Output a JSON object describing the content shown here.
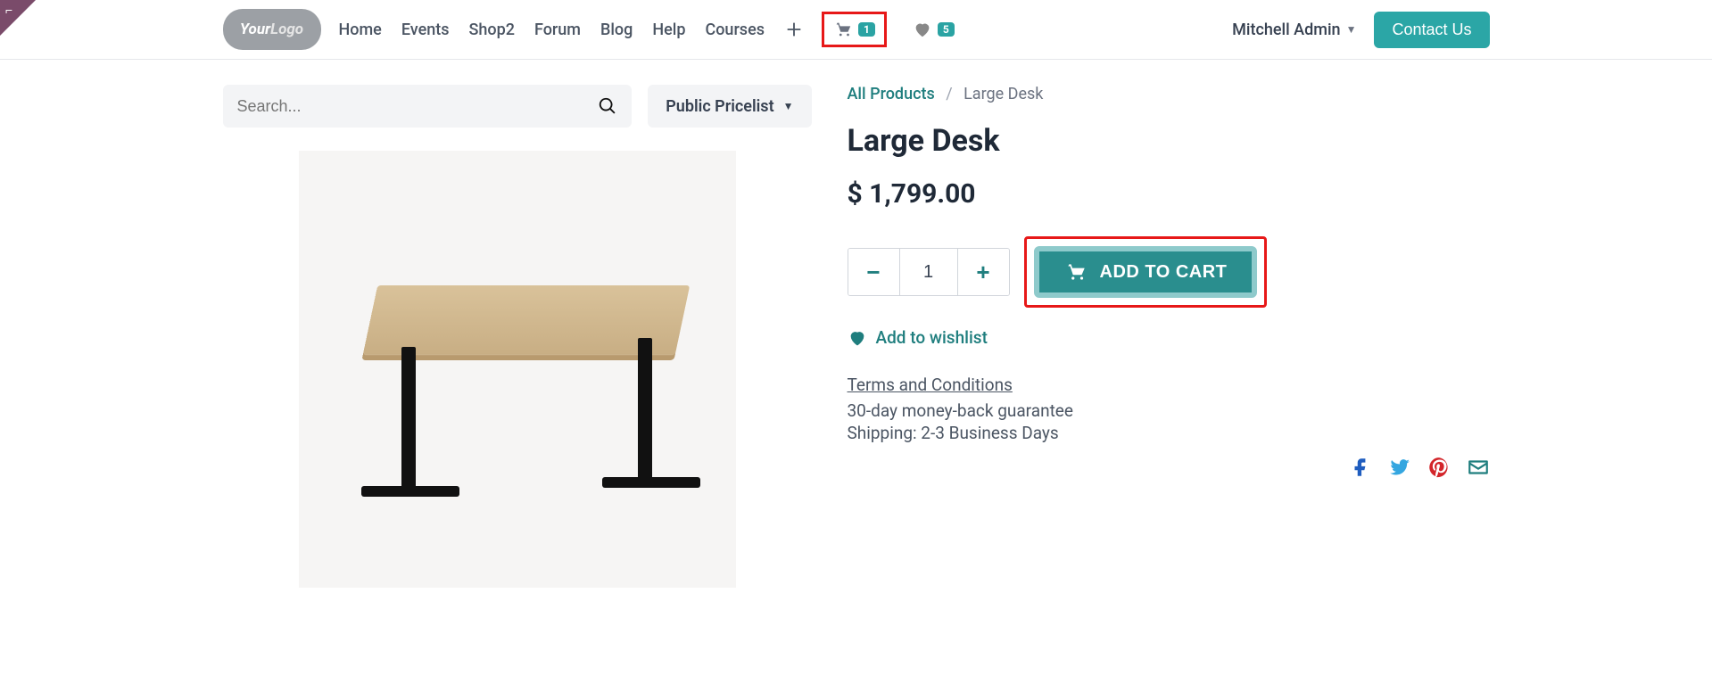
{
  "logo": {
    "part1": "Your",
    "part2": "Logo"
  },
  "nav": {
    "home": "Home",
    "events": "Events",
    "shop": "Shop2",
    "forum": "Forum",
    "blog": "Blog",
    "help": "Help",
    "courses": "Courses"
  },
  "cart_count": "1",
  "wishlist_count": "5",
  "user_name": "Mitchell Admin",
  "contact_btn": "Contact Us",
  "search_placeholder": "Search...",
  "pricelist_label": "Public Pricelist",
  "breadcrumb": {
    "root": "All Products",
    "sep": "/",
    "current": "Large Desk"
  },
  "product": {
    "title": "Large Desk",
    "price": "$ 1,799.00",
    "qty": "1",
    "add_to_cart": "ADD TO CART",
    "wishlist": "Add to wishlist",
    "terms": "Terms and Conditions",
    "guarantee": "30-day money-back guarantee",
    "shipping": "Shipping: 2-3 Business Days"
  }
}
